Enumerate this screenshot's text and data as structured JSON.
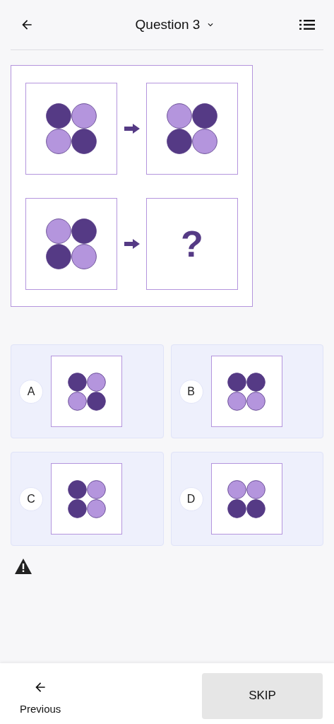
{
  "header": {
    "title": "Question 3"
  },
  "puzzle": {
    "rows": [
      {
        "left": [
          {
            "dark": true
          },
          {
            "dark": false
          },
          {
            "dark": false
          },
          {
            "dark": true
          }
        ],
        "right": {
          "kind": "pattern",
          "circles": [
            {
              "dark": false
            },
            {
              "dark": true
            },
            {
              "dark": true
            },
            {
              "dark": false
            }
          ]
        }
      },
      {
        "left": [
          {
            "dark": false
          },
          {
            "dark": true
          },
          {
            "dark": true
          },
          {
            "dark": false
          }
        ],
        "right": {
          "kind": "unknown",
          "text": "?"
        }
      }
    ]
  },
  "options": [
    {
      "letter": "A",
      "circles": [
        {
          "dark": true
        },
        {
          "dark": false
        },
        {
          "dark": false
        },
        {
          "dark": true
        }
      ]
    },
    {
      "letter": "B",
      "circles": [
        {
          "dark": true
        },
        {
          "dark": true
        },
        {
          "dark": false
        },
        {
          "dark": false
        }
      ]
    },
    {
      "letter": "C",
      "circles": [
        {
          "dark": true
        },
        {
          "dark": false
        },
        {
          "dark": true
        },
        {
          "dark": false
        }
      ]
    },
    {
      "letter": "D",
      "circles": [
        {
          "dark": false
        },
        {
          "dark": false
        },
        {
          "dark": true
        },
        {
          "dark": true
        }
      ]
    }
  ],
  "footer": {
    "previous": "Previous",
    "skip": "SKIP"
  }
}
